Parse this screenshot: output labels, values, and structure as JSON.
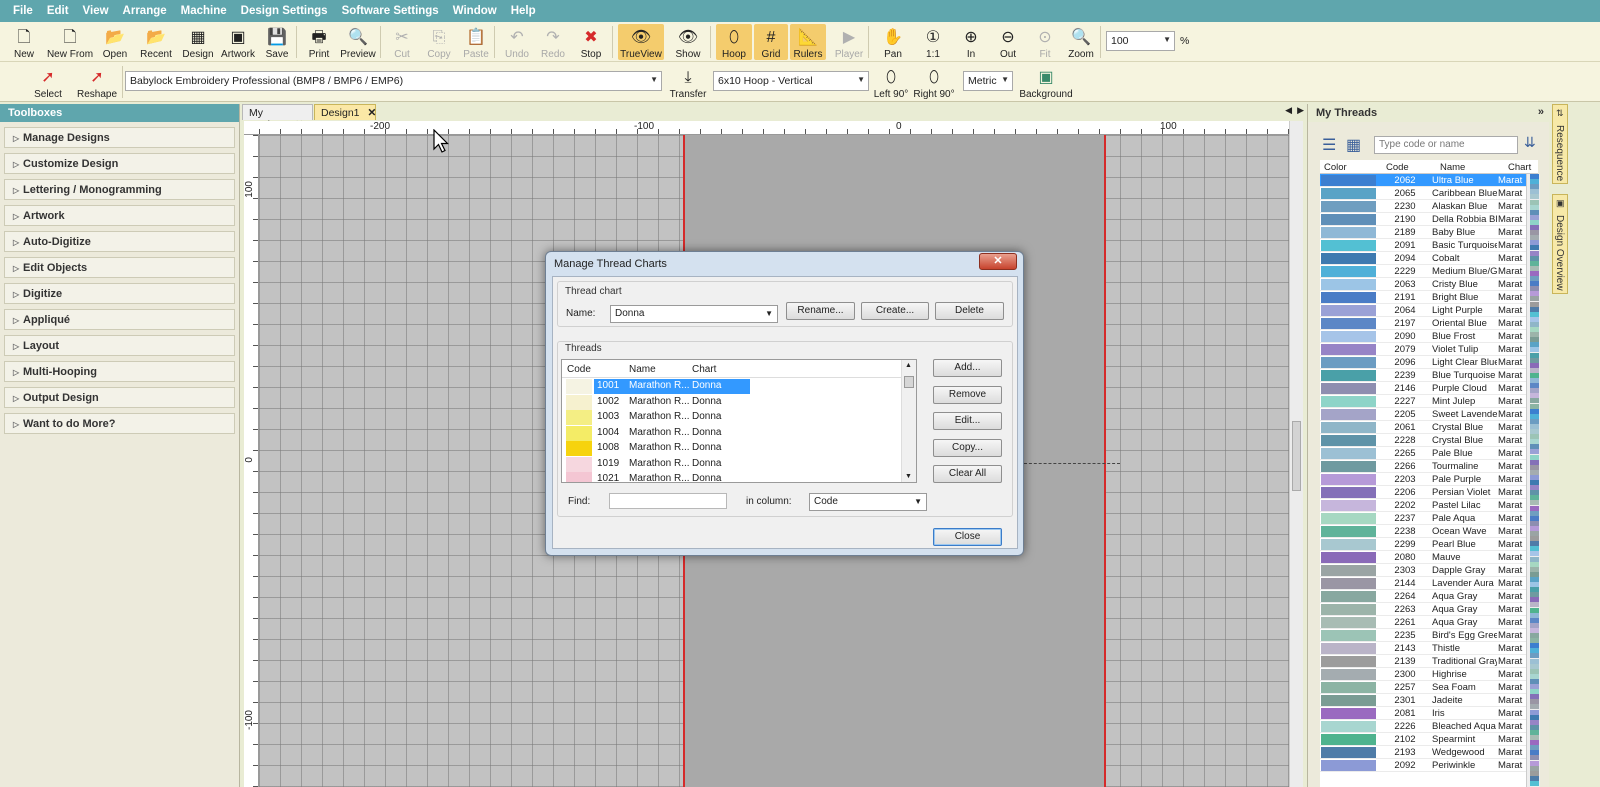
{
  "menu": [
    "File",
    "Edit",
    "View",
    "Arrange",
    "Machine",
    "Design Settings",
    "Software Settings",
    "Window",
    "Help"
  ],
  "toolbar1": [
    {
      "label": "New",
      "icon": "new-icon",
      "glyph": "🗋",
      "enabled": true
    },
    {
      "label": "New From",
      "icon": "new-from-icon",
      "glyph": "🗋",
      "enabled": true
    },
    {
      "label": "Open",
      "icon": "open-folder-icon",
      "glyph": "📂",
      "enabled": true
    },
    {
      "label": "Recent",
      "icon": "recent-icon",
      "glyph": "📂",
      "enabled": true
    },
    {
      "label": "Design",
      "icon": "design-icon",
      "glyph": "▦",
      "enabled": true
    },
    {
      "label": "Artwork",
      "icon": "artwork-icon",
      "glyph": "▣",
      "enabled": true
    },
    {
      "label": "Save",
      "icon": "save-icon",
      "glyph": "💾",
      "enabled": true
    },
    {
      "label": "Print",
      "icon": "print-icon",
      "glyph": "🖶",
      "enabled": true
    },
    {
      "label": "Preview",
      "icon": "preview-icon",
      "glyph": "🔍",
      "enabled": true
    },
    {
      "label": "Cut",
      "icon": "cut-icon",
      "glyph": "✂",
      "enabled": false
    },
    {
      "label": "Copy",
      "icon": "copy-icon",
      "glyph": "⎘",
      "enabled": false
    },
    {
      "label": "Paste",
      "icon": "paste-icon",
      "glyph": "📋",
      "enabled": false
    },
    {
      "label": "Undo",
      "icon": "undo-icon",
      "glyph": "↶",
      "enabled": false
    },
    {
      "label": "Redo",
      "icon": "redo-icon",
      "glyph": "↷",
      "enabled": false
    },
    {
      "label": "Stop",
      "icon": "stop-icon",
      "glyph": "✖",
      "enabled": true
    },
    {
      "label": "TrueView",
      "icon": "trueview-eye-icon",
      "glyph": "👁",
      "enabled": true,
      "active": true
    },
    {
      "label": "Show",
      "icon": "show-eye-icon",
      "glyph": "👁",
      "enabled": true
    },
    {
      "label": "Hoop",
      "icon": "hoop-icon",
      "glyph": "⬯",
      "enabled": true,
      "active": true
    },
    {
      "label": "Grid",
      "icon": "grid-icon",
      "glyph": "#",
      "enabled": true,
      "active": true
    },
    {
      "label": "Rulers",
      "icon": "rulers-icon",
      "glyph": "📐",
      "enabled": true,
      "active": true
    },
    {
      "label": "Player",
      "icon": "player-icon",
      "glyph": "▶",
      "enabled": false
    },
    {
      "label": "Pan",
      "icon": "pan-hand-icon",
      "glyph": "✋",
      "enabled": true
    },
    {
      "label": "1:1",
      "icon": "zoom-1to1-icon",
      "glyph": "①",
      "enabled": true
    },
    {
      "label": "In",
      "icon": "zoom-in-icon",
      "glyph": "⊕",
      "enabled": true
    },
    {
      "label": "Out",
      "icon": "zoom-out-icon",
      "glyph": "⊖",
      "enabled": true
    },
    {
      "label": "Fit",
      "icon": "zoom-fit-icon",
      "glyph": "⊙",
      "enabled": false
    },
    {
      "label": "Zoom",
      "icon": "zoom-icon",
      "glyph": "🔍",
      "enabled": true
    }
  ],
  "zoom": {
    "value": "100",
    "unit": "%"
  },
  "toolbar2": {
    "select_label": "Select",
    "reshape_label": "Reshape",
    "machine_format": "Babylock Embroidery Professional (BMP8 / BMP6 / EMP6)",
    "transfer_label": "Transfer",
    "hoop": "6x10 Hoop - Vertical",
    "left90_label": "Left 90°",
    "right90_label": "Right 90°",
    "units": "Metric",
    "background_label": "Background"
  },
  "toolboxes": {
    "title": "Toolboxes",
    "items": [
      "Manage Designs",
      "Customize Design",
      "Lettering / Monogramming",
      "Artwork",
      "Auto-Digitize",
      "Edit Objects",
      "Digitize",
      "Appliqué",
      "Layout",
      "Multi-Hooping",
      "Output Design",
      "Want to do More?"
    ]
  },
  "tabs": [
    {
      "label": "My Designs",
      "active": false
    },
    {
      "label": "Design1",
      "active": true
    }
  ],
  "ruler": {
    "top": [
      "-200",
      "-100",
      "0",
      "100"
    ],
    "left": [
      "100",
      "0",
      "-100"
    ]
  },
  "dialog": {
    "title": "Manage Thread Charts",
    "thread_chart_group": "Thread chart",
    "name_label": "Name:",
    "name_value": "Donna",
    "rename_label": "Rename...",
    "create_label": "Create...",
    "delete_label": "Delete",
    "threads_group": "Threads",
    "columns": [
      "Code",
      "Name",
      "Chart"
    ],
    "rows": [
      {
        "code": "1001",
        "name": "Marathon R...",
        "chart": "Donna",
        "color": "#f5f3e3",
        "selected": true
      },
      {
        "code": "1002",
        "name": "Marathon R...",
        "chart": "Donna",
        "color": "#f6f1cf"
      },
      {
        "code": "1003",
        "name": "Marathon R...",
        "chart": "Donna",
        "color": "#f4ee84"
      },
      {
        "code": "1004",
        "name": "Marathon R...",
        "chart": "Donna",
        "color": "#f4ec66"
      },
      {
        "code": "1008",
        "name": "Marathon R...",
        "chart": "Donna",
        "color": "#f6d30e"
      },
      {
        "code": "1019",
        "name": "Marathon R...",
        "chart": "Donna",
        "color": "#f6d7df"
      },
      {
        "code": "1021",
        "name": "Marathon R...",
        "chart": "Donna",
        "color": "#f4c6d3"
      }
    ],
    "add_label": "Add...",
    "remove_label": "Remove",
    "edit_label": "Edit...",
    "copy_label": "Copy...",
    "clear_all_label": "Clear All",
    "find_label": "Find:",
    "find_value": "",
    "in_column_label": "in column:",
    "in_column_value": "Code",
    "close_label": "Close"
  },
  "my_threads": {
    "title": "My Threads",
    "search_placeholder": "Type code or name",
    "columns": [
      "Color",
      "Code",
      "Name",
      "Chart"
    ],
    "rows": [
      {
        "code": "2062",
        "name": "Ultra Blue",
        "chart": "Marat",
        "color": "#3c7fd0",
        "selected": true
      },
      {
        "code": "2065",
        "name": "Caribbean Blue",
        "chart": "Marat",
        "color": "#5aa3c6"
      },
      {
        "code": "2230",
        "name": "Alaskan Blue",
        "chart": "Marat",
        "color": "#6f9ec0"
      },
      {
        "code": "2190",
        "name": "Della Robbia Blue",
        "chart": "Marat",
        "color": "#5f8fb8"
      },
      {
        "code": "2189",
        "name": "Baby Blue",
        "chart": "Marat",
        "color": "#8fb8d6"
      },
      {
        "code": "2091",
        "name": "Basic Turquoise",
        "chart": "Marat",
        "color": "#53c0d3"
      },
      {
        "code": "2094",
        "name": "Cobalt",
        "chart": "Marat",
        "color": "#3e7ab0"
      },
      {
        "code": "2229",
        "name": "Medium Blue/Grey",
        "chart": "Marat",
        "color": "#4fb0d8"
      },
      {
        "code": "2063",
        "name": "Cristy Blue",
        "chart": "Marat",
        "color": "#9cc5e6"
      },
      {
        "code": "2191",
        "name": "Bright Blue",
        "chart": "Marat",
        "color": "#4a7cc6"
      },
      {
        "code": "2064",
        "name": "Light Purple",
        "chart": "Marat",
        "color": "#9aa1d6"
      },
      {
        "code": "2197",
        "name": "Oriental Blue",
        "chart": "Marat",
        "color": "#5c87c6"
      },
      {
        "code": "2090",
        "name": "Blue Frost",
        "chart": "Marat",
        "color": "#a6c4e8"
      },
      {
        "code": "2079",
        "name": "Violet Tulip",
        "chart": "Marat",
        "color": "#9784c6"
      },
      {
        "code": "2096",
        "name": "Light Clear Blue",
        "chart": "Marat",
        "color": "#6c9cc2"
      },
      {
        "code": "2239",
        "name": "Blue Turquoise",
        "chart": "Marat",
        "color": "#4aa0a8"
      },
      {
        "code": "2146",
        "name": "Purple Cloud",
        "chart": "Marat",
        "color": "#8e8eb0"
      },
      {
        "code": "2227",
        "name": "Mint Julep",
        "chart": "Marat",
        "color": "#8ed4c8"
      },
      {
        "code": "2205",
        "name": "Sweet Lavender",
        "chart": "Marat",
        "color": "#a4a4c8"
      },
      {
        "code": "2061",
        "name": "Crystal Blue",
        "chart": "Marat",
        "color": "#8fb6c8"
      },
      {
        "code": "2228",
        "name": "Crystal Blue",
        "chart": "Marat",
        "color": "#5f93a8"
      },
      {
        "code": "2265",
        "name": "Pale Blue",
        "chart": "Marat",
        "color": "#9cc0d4"
      },
      {
        "code": "2266",
        "name": "Tourmaline",
        "chart": "Marat",
        "color": "#6f9aa0"
      },
      {
        "code": "2203",
        "name": "Pale Purple",
        "chart": "Marat",
        "color": "#b69ad8"
      },
      {
        "code": "2206",
        "name": "Persian Violet",
        "chart": "Marat",
        "color": "#8470b8"
      },
      {
        "code": "2202",
        "name": "Pastel Lilac",
        "chart": "Marat",
        "color": "#c6b6dc"
      },
      {
        "code": "2237",
        "name": "Pale Aqua",
        "chart": "Marat",
        "color": "#a6d8c2"
      },
      {
        "code": "2238",
        "name": "Ocean Wave",
        "chart": "Marat",
        "color": "#5fb39a"
      },
      {
        "code": "2299",
        "name": "Pearl Blue",
        "chart": "Marat",
        "color": "#a8c8d0"
      },
      {
        "code": "2080",
        "name": "Mauve",
        "chart": "Marat",
        "color": "#8a6ab8"
      },
      {
        "code": "2303",
        "name": "Dapple Gray",
        "chart": "Marat",
        "color": "#9aa4a4"
      },
      {
        "code": "2144",
        "name": "Lavender Aura",
        "chart": "Marat",
        "color": "#9a96a4"
      },
      {
        "code": "2264",
        "name": "Aqua Gray",
        "chart": "Marat",
        "color": "#88a8a0"
      },
      {
        "code": "2263",
        "name": "Aqua Gray",
        "chart": "Marat",
        "color": "#9cb4aa"
      },
      {
        "code": "2261",
        "name": "Aqua Gray",
        "chart": "Marat",
        "color": "#a8bcb4"
      },
      {
        "code": "2235",
        "name": "Bird's Egg Green",
        "chart": "Marat",
        "color": "#9cc4b6"
      },
      {
        "code": "2143",
        "name": "Thistle",
        "chart": "Marat",
        "color": "#bab4c8"
      },
      {
        "code": "2139",
        "name": "Traditional Gray",
        "chart": "Marat",
        "color": "#9c9c9c"
      },
      {
        "code": "2300",
        "name": "Highrise",
        "chart": "Marat",
        "color": "#a4acb0"
      },
      {
        "code": "2257",
        "name": "Sea Foam",
        "chart": "Marat",
        "color": "#8cb4a4"
      },
      {
        "code": "2301",
        "name": "Jadeite",
        "chart": "Marat",
        "color": "#7a9c94"
      },
      {
        "code": "2081",
        "name": "Iris",
        "chart": "Marat",
        "color": "#9a6ac0"
      },
      {
        "code": "2226",
        "name": "Bleached Aqua",
        "chart": "Marat",
        "color": "#a8d6d0"
      },
      {
        "code": "2102",
        "name": "Spearmint",
        "chart": "Marat",
        "color": "#4fb38e"
      },
      {
        "code": "2193",
        "name": "Wedgewood",
        "chart": "Marat",
        "color": "#4f7ca8"
      },
      {
        "code": "2092",
        "name": "Periwinkle",
        "chart": "Marat",
        "color": "#8c9ad6"
      }
    ]
  },
  "side_tabs": [
    "Resequence",
    "Design Overview"
  ]
}
